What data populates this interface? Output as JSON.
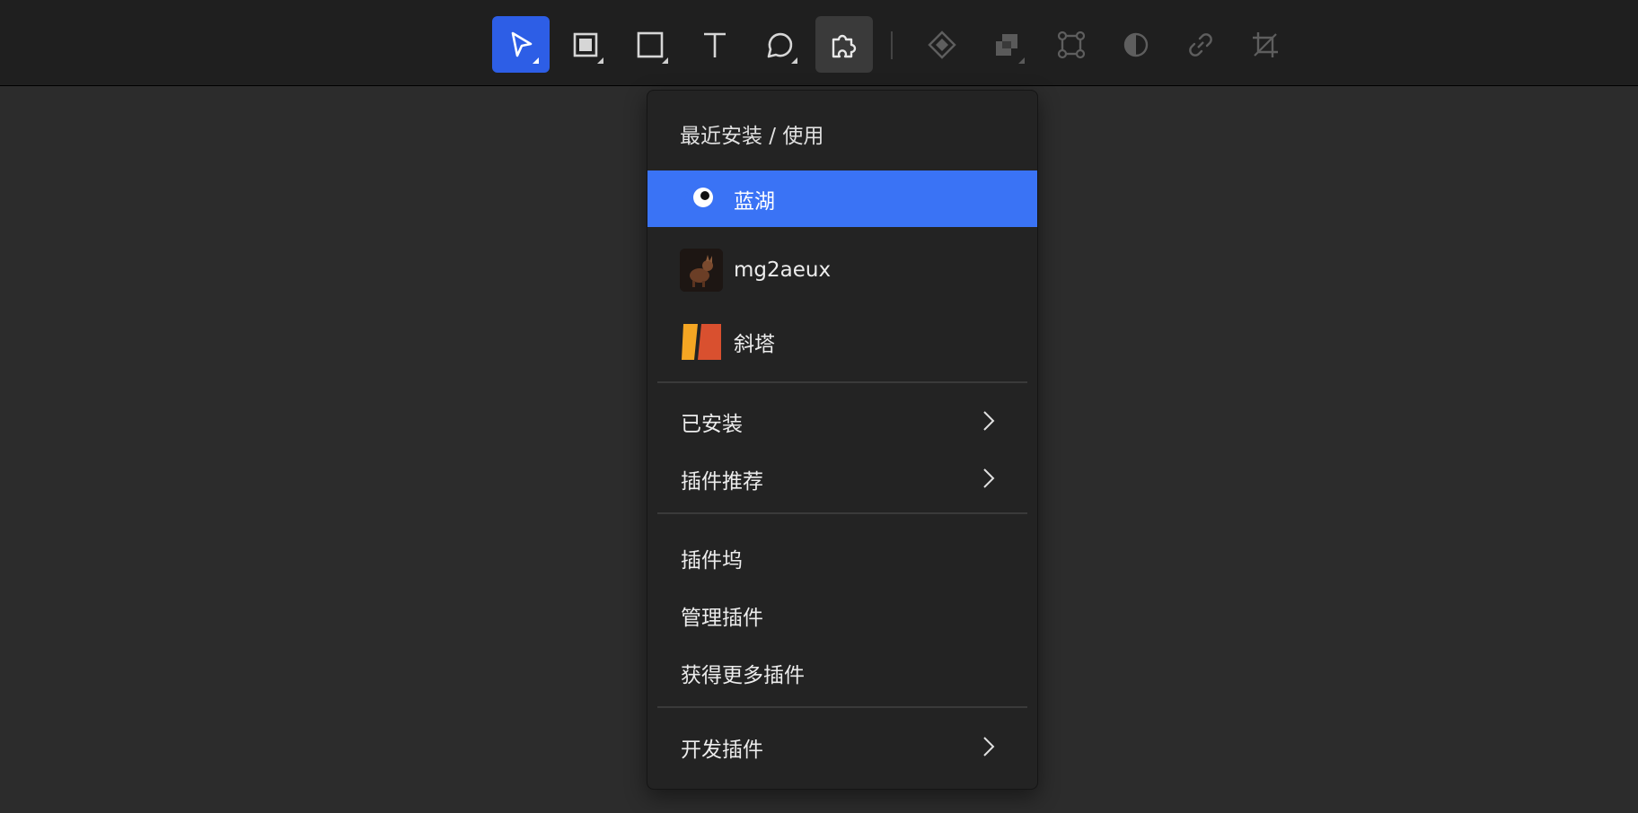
{
  "toolbar": {
    "tools": [
      {
        "name": "move-tool",
        "icon": "cursor-arrow-icon",
        "state": "active"
      },
      {
        "name": "frame-tool",
        "icon": "frame-icon",
        "state": "normal"
      },
      {
        "name": "rectangle-tool",
        "icon": "rectangle-icon",
        "state": "normal"
      },
      {
        "name": "text-tool",
        "icon": "text-icon",
        "state": "normal"
      },
      {
        "name": "comment-tool",
        "icon": "comment-bubble-icon",
        "state": "normal"
      },
      {
        "name": "plugin-tool",
        "icon": "puzzle-piece-icon",
        "state": "open"
      },
      {
        "name": "component-tool",
        "icon": "component-diamond-icon",
        "state": "disabled"
      },
      {
        "name": "boolean-tool",
        "icon": "boolean-union-icon",
        "state": "disabled"
      },
      {
        "name": "vector-edit-tool",
        "icon": "vector-edit-icon",
        "state": "disabled"
      },
      {
        "name": "mask-tool",
        "icon": "mask-icon",
        "state": "disabled"
      },
      {
        "name": "link-tool",
        "icon": "link-icon",
        "state": "disabled"
      },
      {
        "name": "crop-tool",
        "icon": "crop-icon",
        "state": "disabled"
      }
    ],
    "active_color": "#2d5ee6"
  },
  "menu": {
    "header": "最近安装 / 使用",
    "recent": [
      {
        "label": "蓝湖",
        "icon": "lanhu-logo-icon",
        "selected": true
      },
      {
        "label": "mg2aeux",
        "icon": "mg2aeux-avatar-icon",
        "selected": false
      },
      {
        "label": "斜塔",
        "icon": "xieta-logo-icon",
        "selected": false
      }
    ],
    "submenus": [
      {
        "label": "已安装"
      },
      {
        "label": "插件推荐"
      }
    ],
    "actions": [
      {
        "label": "插件坞"
      },
      {
        "label": "管理插件"
      },
      {
        "label": "获得更多插件"
      }
    ],
    "dev": {
      "label": "开发插件"
    },
    "selected_color": "#3a73f5"
  }
}
